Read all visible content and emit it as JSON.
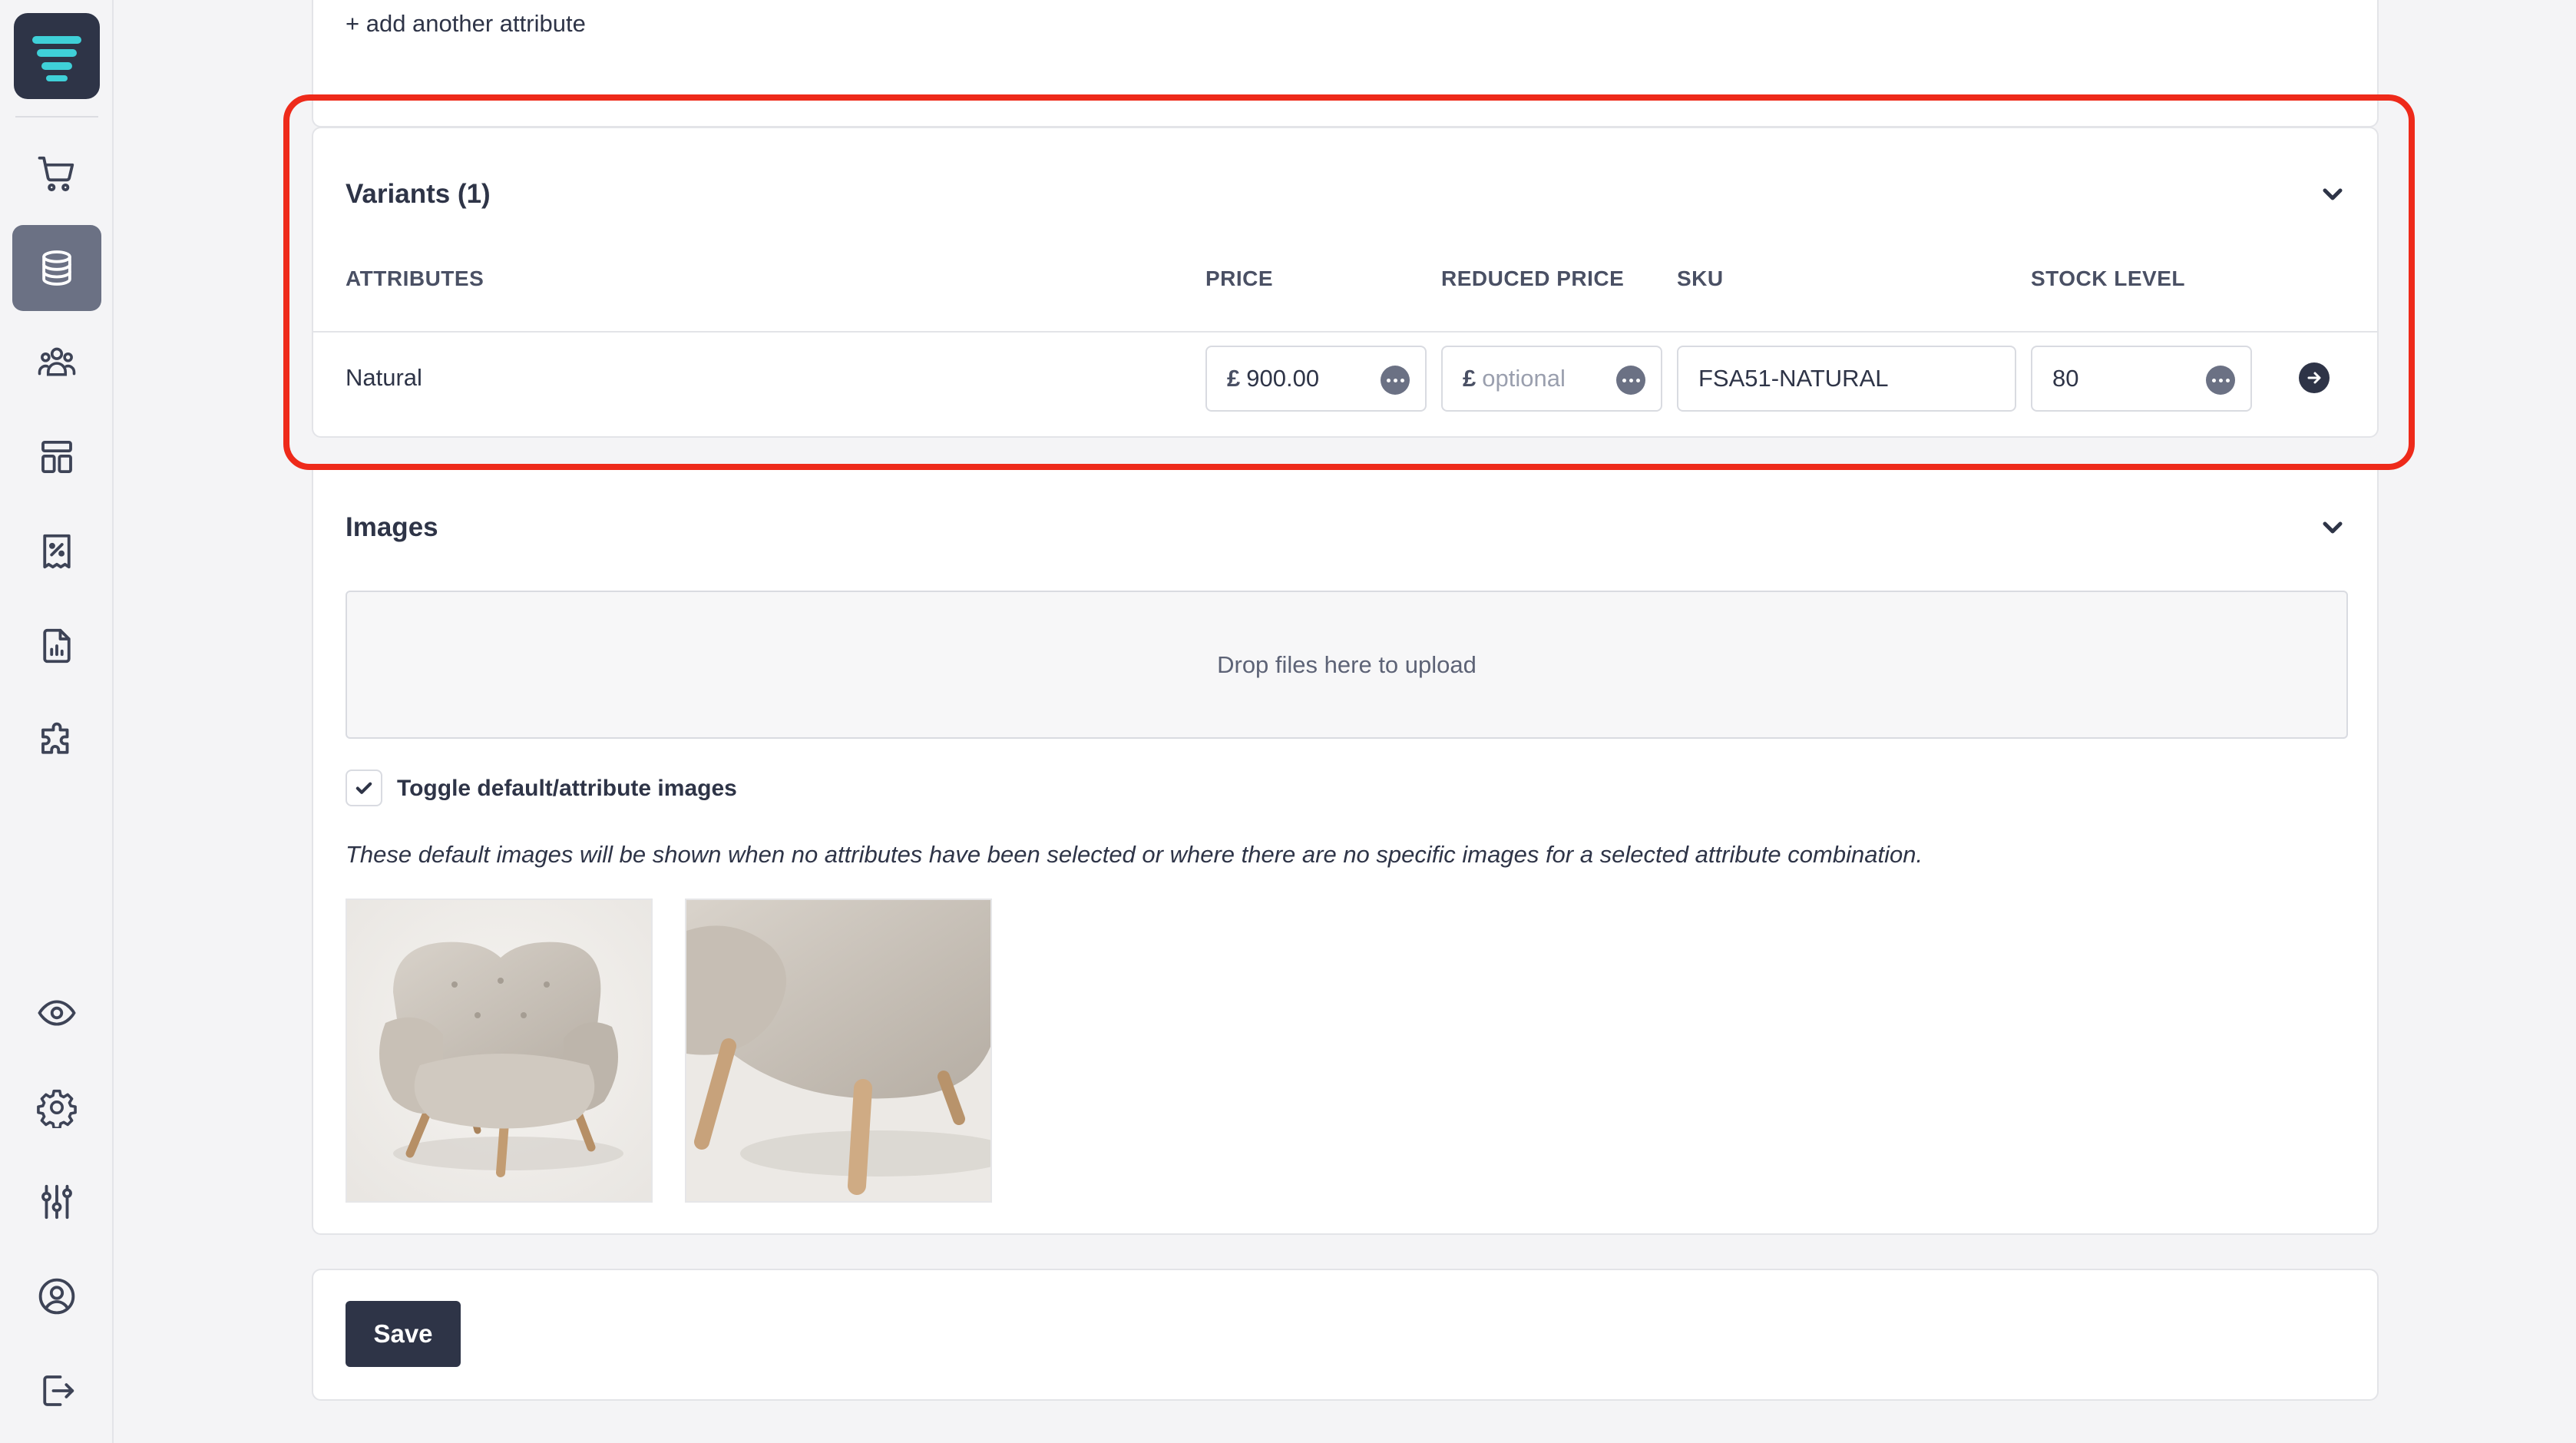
{
  "sidebar": {
    "logo": "logo-icon",
    "items": [
      {
        "name": "nav-orders",
        "icon": "cart-icon"
      },
      {
        "name": "nav-products",
        "icon": "database-icon",
        "active": true
      },
      {
        "name": "nav-customers",
        "icon": "users-icon"
      },
      {
        "name": "nav-content",
        "icon": "layout-icon"
      },
      {
        "name": "nav-discounts",
        "icon": "receipt-percent-icon"
      },
      {
        "name": "nav-reports",
        "icon": "report-chart-icon"
      },
      {
        "name": "nav-plugins",
        "icon": "puzzle-icon"
      },
      {
        "name": "nav-preview",
        "icon": "eye-icon"
      },
      {
        "name": "nav-settings",
        "icon": "gear-icon"
      },
      {
        "name": "nav-adjustments",
        "icon": "sliders-icon"
      },
      {
        "name": "nav-account",
        "icon": "user-circle-icon"
      },
      {
        "name": "nav-logout",
        "icon": "logout-icon"
      }
    ]
  },
  "attributes_section": {
    "add_link": "+ add another attribute"
  },
  "variants": {
    "title": "Variants (1)",
    "columns": {
      "attributes": "ATTRIBUTES",
      "price": "PRICE",
      "reduced_price": "REDUCED PRICE",
      "sku": "SKU",
      "stock_level": "STOCK LEVEL"
    },
    "rows": [
      {
        "attribute": "Natural",
        "currency": "£",
        "price": "900.00",
        "reduced_currency": "£",
        "reduced_placeholder": "optional",
        "sku": "FSA51-NATURAL",
        "stock": "80"
      }
    ]
  },
  "images": {
    "title": "Images",
    "dropzone": "Drop files here to upload",
    "toggle_label": "Toggle default/attribute images",
    "toggle_checked": true,
    "help_text": "These default images will be shown when no attributes have been selected or where there are no specific images for a selected attribute combination."
  },
  "actions": {
    "save_label": "Save"
  },
  "colors": {
    "brand_dark": "#2e3447",
    "highlight": "#ee2a1a",
    "logo_accent": "#3fd0d8"
  }
}
